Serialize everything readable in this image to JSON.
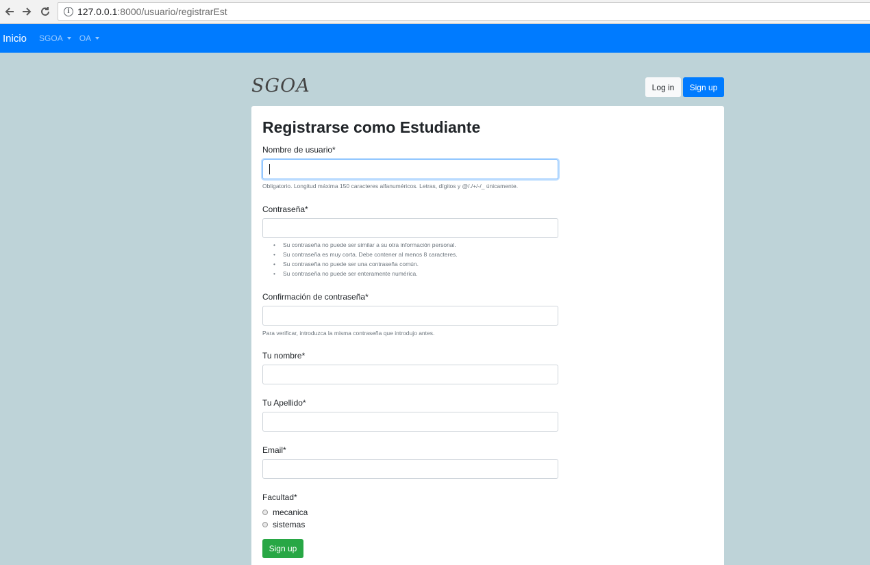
{
  "browser": {
    "url_host": "127.0.0.1",
    "url_path": ":8000/usuario/registrarEst"
  },
  "navbar": {
    "brand": "Inicio",
    "items": [
      {
        "label": "SGOA"
      },
      {
        "label": "OA"
      }
    ]
  },
  "header": {
    "logo": "SGOA",
    "login_label": "Log in",
    "signup_label": "Sign up"
  },
  "form": {
    "title": "Registrarse como Estudiante",
    "username": {
      "label": "Nombre de usuario*",
      "value": "",
      "help": "Obligatorio. Longitud máxima 150 caracteres alfanuméricos. Letras, dígitos y @/./+/-/_ únicamente."
    },
    "password": {
      "label": "Contraseña*",
      "value": "",
      "help": [
        "Su contraseña no puede ser similar a su otra información personal.",
        "Su contraseña es muy corta. Debe contener al menos 8 caracteres.",
        "Su contraseña no puede ser una contraseña común.",
        "Su contraseña no puede ser enteramente numérica."
      ]
    },
    "password_confirm": {
      "label": "Confirmación de contraseña*",
      "value": "",
      "help": "Para verificar, introduzca la misma contraseña que introdujo antes."
    },
    "first_name": {
      "label": "Tu nombre*",
      "value": ""
    },
    "last_name": {
      "label": "Tu Apellido*",
      "value": ""
    },
    "email": {
      "label": "Email*",
      "value": ""
    },
    "faculty": {
      "label": "Facultad*",
      "options": [
        "mecanica",
        "sistemas"
      ]
    },
    "submit_label": "Sign up"
  },
  "colors": {
    "navbar": "#007bff",
    "background": "#bed3d8",
    "submit": "#28a745"
  }
}
